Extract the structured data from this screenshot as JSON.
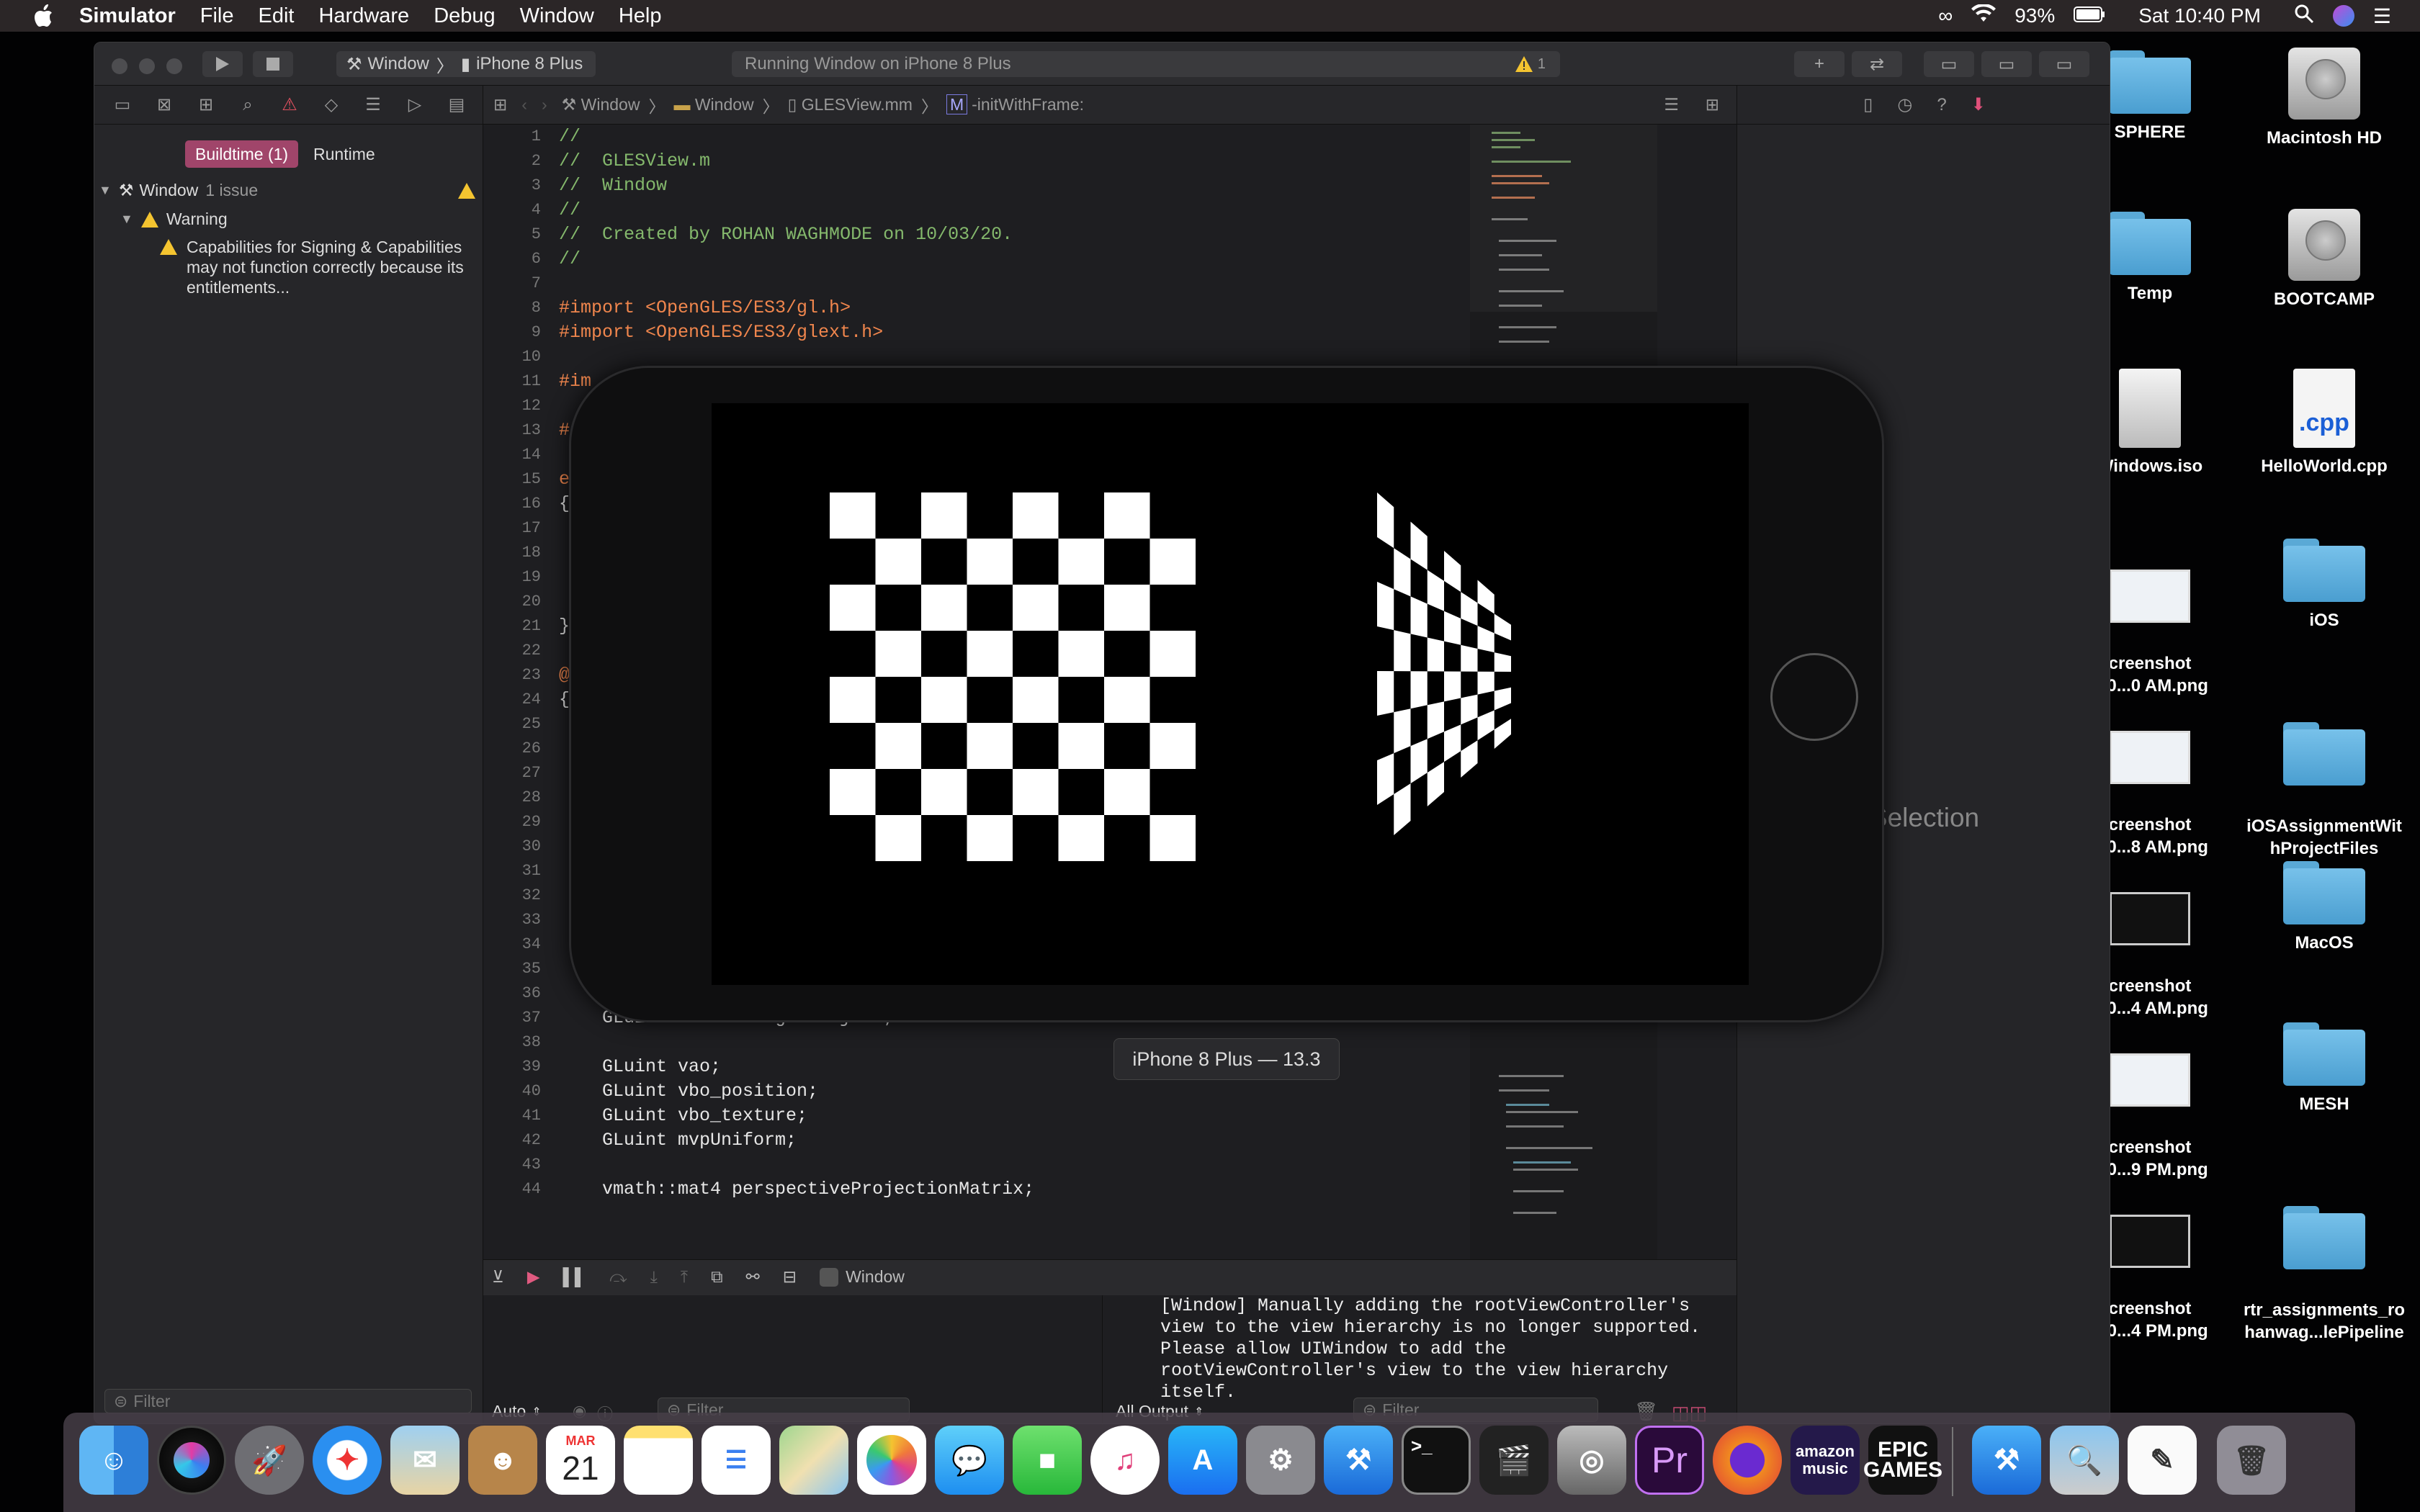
{
  "menubar": {
    "app": "Simulator",
    "items": [
      "File",
      "Edit",
      "Hardware",
      "Debug",
      "Window",
      "Help"
    ],
    "battery": "93%",
    "clock": "Sat 10:40 PM"
  },
  "desktop": {
    "icons": [
      "SPHERE",
      "Macintosh HD",
      "Temp",
      "BOOTCAMP",
      "Windows.iso",
      "HelloWorld.cpp",
      "creenshot\n0-0...0 AM.png",
      "iOS",
      "creenshot\n0-0...8 AM.png",
      "iOSAssignmentWit\nhProjectFiles",
      "creenshot\n0-0...4 AM.png",
      "MacOS",
      "creenshot\n0-0...9 PM.png",
      "MESH",
      "creenshot\n0-0...4 PM.png",
      "rtr_assignments_ro\nhanwag...lePipeline"
    ],
    "cpp_ext": ".cpp"
  },
  "toolbar": {
    "scheme": "Window",
    "device": "iPhone 8 Plus",
    "status": "Running Window on iPhone 8 Plus",
    "warning_count": "1"
  },
  "navigator": {
    "tab_buildtime": "Buildtime (1)",
    "tab_runtime": "Runtime",
    "project": "Window",
    "project_issues": "1 issue",
    "group": "Warning",
    "issue": "Capabilities for Signing & Capabilities may not function correctly because its entitlements...",
    "filter_placeholder": "Filter"
  },
  "jumpbar": {
    "crumbs": [
      "Window",
      "Window",
      "GLESView.mm",
      "-initWithFrame:"
    ]
  },
  "editor": {
    "line_numbers": [
      "1",
      "2",
      "3",
      "4",
      "5",
      "6",
      "7",
      "8",
      "9",
      "10",
      "11",
      "12",
      "13",
      "14",
      "15",
      "16",
      "17",
      "18",
      "19",
      "20",
      "21",
      "22",
      "23",
      "24",
      "25",
      "26",
      "27",
      "28",
      "29",
      "30",
      "31",
      "32",
      "33",
      "34",
      "35",
      "36",
      "37",
      "38",
      "39",
      "40",
      "41",
      "42",
      "43",
      "44"
    ],
    "lines": [
      "//",
      "//  GLESView.m",
      "//  Window",
      "//",
      "//  Created by ROHAN WAGHMODE on 10/03/20.",
      "//",
      "",
      "#import <OpenGLES/ES3/gl.h>",
      "#import <OpenGLES/ES3/glext.h>",
      "",
      "#im",
      "",
      "#",
      "",
      "e",
      "{",
      "",
      "",
      "",
      "",
      "}",
      "",
      "@",
      "{",
      "",
      "",
      "",
      "",
      "",
      "",
      "",
      "",
      "",
      "",
      "",
      "",
      "    GLuint shaderProgramObject;",
      "",
      "    GLuint vao;",
      "    GLuint vbo_position;",
      "    GLuint vbo_texture;",
      "    GLuint mvpUniform;",
      "",
      "    vmath::mat4 perspectiveProjectionMatrix;"
    ]
  },
  "inspector": {
    "placeholder": "Selection"
  },
  "debug": {
    "target": "Window",
    "auto_label": "Auto",
    "output_label": "All Output",
    "filter_placeholder": "Filter",
    "console": "[Window] Manually adding the rootViewController's\nview to the view hierarchy is no longer supported.\nPlease allow UIWindow to add the\nrootViewController's view to the view hierarchy\nitself."
  },
  "simulator": {
    "label": "iPhone 8 Plus — 13.3"
  },
  "dock": {
    "calendar_month": "MAR",
    "calendar_day": "21",
    "apps": [
      "finder-icon",
      "siri-icon",
      "launchpad-icon",
      "safari-icon",
      "mail-icon",
      "contacts-icon",
      "calendar-icon",
      "notes-icon",
      "reminders-icon",
      "maps-icon",
      "photos-icon",
      "messages-icon",
      "facetime-icon",
      "itunes-icon",
      "app-store-icon",
      "system-preferences-icon",
      "xcode-icon",
      "terminal-icon",
      "final-cut-icon",
      "disk-utility-icon",
      "premiere-icon",
      "firefox-icon",
      "amazon-music-icon",
      "epic-games-icon",
      "xcode-2-icon",
      "preview-icon",
      "textedit-icon",
      "trash-icon"
    ],
    "premiere_text": "Pr",
    "amazon_text": "amazon\nmusic",
    "epic_text": "EPIC\nGAMES"
  },
  "colors": {
    "accent_pink": "#a0456a",
    "warning_yellow": "#f4c430",
    "comment_green": "#84b86c",
    "preproc_orange": "#f0864d"
  }
}
